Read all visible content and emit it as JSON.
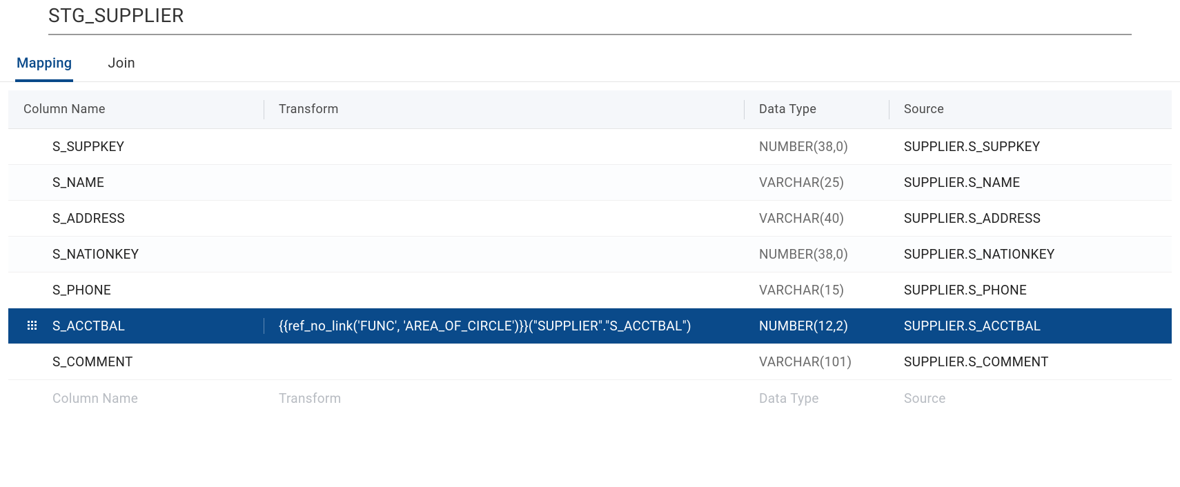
{
  "title": "STG_SUPPLIER",
  "tabs": [
    {
      "label": "Mapping",
      "active": true
    },
    {
      "label": "Join",
      "active": false
    }
  ],
  "columns": {
    "name": "Column Name",
    "transform": "Transform",
    "datatype": "Data Type",
    "source": "Source"
  },
  "rows": [
    {
      "name": "S_SUPPKEY",
      "transform": "",
      "datatype": "NUMBER(38,0)",
      "source": "SUPPLIER.S_SUPPKEY",
      "selected": false
    },
    {
      "name": "S_NAME",
      "transform": "",
      "datatype": "VARCHAR(25)",
      "source": "SUPPLIER.S_NAME",
      "selected": false
    },
    {
      "name": "S_ADDRESS",
      "transform": "",
      "datatype": "VARCHAR(40)",
      "source": "SUPPLIER.S_ADDRESS",
      "selected": false
    },
    {
      "name": "S_NATIONKEY",
      "transform": "",
      "datatype": "NUMBER(38,0)",
      "source": "SUPPLIER.S_NATIONKEY",
      "selected": false
    },
    {
      "name": "S_PHONE",
      "transform": "",
      "datatype": "VARCHAR(15)",
      "source": "SUPPLIER.S_PHONE",
      "selected": false
    },
    {
      "name": "S_ACCTBAL",
      "transform": "{{ref_no_link('FUNC', 'AREA_OF_CIRCLE')}}(\"SUPPLIER\".\"S_ACCTBAL\")",
      "datatype": "NUMBER(12,2)",
      "source": "SUPPLIER.S_ACCTBAL",
      "selected": true
    },
    {
      "name": "S_COMMENT",
      "transform": "",
      "datatype": "VARCHAR(101)",
      "source": "SUPPLIER.S_COMMENT",
      "selected": false
    }
  ],
  "placeholders": {
    "name": "Column Name",
    "transform": "Transform",
    "datatype": "Data Type",
    "source": "Source"
  }
}
